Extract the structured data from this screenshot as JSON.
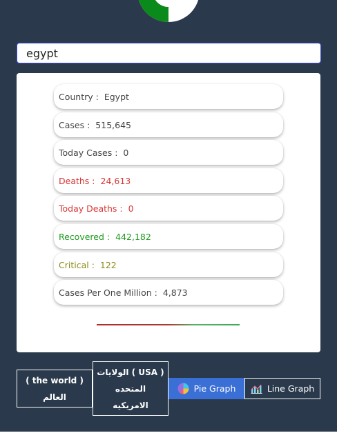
{
  "search": {
    "value": "egypt"
  },
  "stats": [
    {
      "label": "Country :",
      "value": "Egypt"
    },
    {
      "label": "Cases :",
      "value": "515,645"
    },
    {
      "label": "Today Cases :",
      "value": "0"
    },
    {
      "label": "Deaths :",
      "value": "24,613"
    },
    {
      "label": "Today Deaths :",
      "value": "0"
    },
    {
      "label": "Recovered :",
      "value": "442,182"
    },
    {
      "label": "Critical :",
      "value": "122"
    },
    {
      "label": "Cases Per One Million :",
      "value": "4,873"
    }
  ],
  "colors": {
    "background": "#2a3a4c",
    "deaths": "#d93535",
    "recovered": "#1f9a1f",
    "critical": "#8d8a16",
    "pie_button": "#3a6fd6",
    "logo_green": "#0a8a1a"
  },
  "buttons": {
    "world_line1": "( the world )",
    "world_line2": "العالم",
    "usa_line1": "الولايات ( USA )",
    "usa_line2": "المتحده",
    "usa_line3": "الامريكيه",
    "pie_label": "Pie Graph",
    "pie_icon": "pie-chart-icon",
    "line_label": "Line Graph",
    "line_icon": "line-chart-icon"
  }
}
